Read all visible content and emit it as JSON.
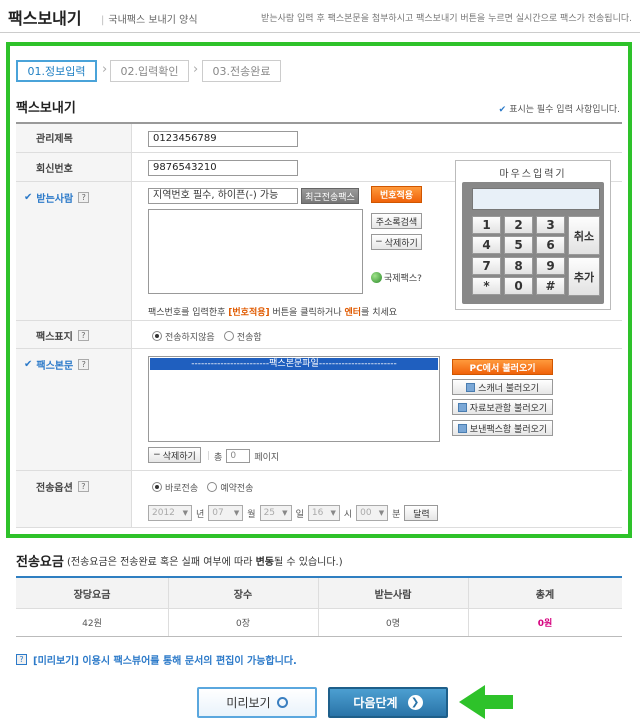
{
  "header": {
    "title": "팩스보내기",
    "subtitle": "국내팩스 보내기 양식",
    "description": "받는사람 입력 후 팩스본문을 첨부하시고 팩스보내기 버튼을 누르면 실시간으로 팩스가 전송됩니다."
  },
  "steps": [
    {
      "label": "01.정보입력",
      "active": true
    },
    {
      "label": "02.입력확인",
      "active": false
    },
    {
      "label": "03.전송완료",
      "active": false
    }
  ],
  "section_title": "팩스보내기",
  "required_note": "표시는 필수 입력 사항입니다.",
  "form": {
    "mgmt_title": {
      "label": "관리제목",
      "value": "0123456789"
    },
    "reply_number": {
      "label": "회신번호",
      "value": "9876543210"
    },
    "recipient": {
      "label": "받는사람",
      "input_value": "지역번호 필수, 하이픈(-) 가능",
      "recent_button": "최근전송팩스",
      "apply_button": "번호적용",
      "address_search_button": "주소록검색",
      "delete_button": "삭제하기",
      "intl_fax_link": "국제팩스?",
      "hint_prefix": "팩스번호를 입력한후",
      "hint_btn": "[번호적용]",
      "hint_mid": "버튼을 클릭하거나",
      "hint_enter": "엔터",
      "hint_suffix": "를 치세요"
    },
    "cover": {
      "label": "팩스표지",
      "options": [
        "전송하지않음",
        "전송함"
      ],
      "selected": "전송하지않음"
    },
    "body": {
      "label": "팩스본문",
      "list_item": "------------------------팩스본문파일------------------------",
      "pc_load_button": "PC에서 불러오기",
      "scanner_button": "스캐너 불러오기",
      "archive_button": "자료보관함 불러오기",
      "sent_fax_button": "보낸팩스함 불러오기",
      "delete_button": "삭제하기",
      "total_label": "총",
      "pages_value": "0",
      "pages_label": "페이지"
    },
    "send_option": {
      "label": "전송옵션",
      "options": [
        "바로전송",
        "예약전송"
      ],
      "selected": "바로전송",
      "year": "2012",
      "year_unit": "년",
      "month": "07",
      "month_unit": "월",
      "day": "25",
      "day_unit": "일",
      "hour": "16",
      "hour_unit": "시",
      "minute": "00",
      "minute_unit": "분",
      "calendar_button": "달력"
    }
  },
  "keypad": {
    "title": "마우스입력기",
    "keys": [
      "1",
      "2",
      "3",
      "4",
      "5",
      "6",
      "7",
      "8",
      "9",
      "*",
      "0",
      "#"
    ],
    "cancel": "취소",
    "add": "추가"
  },
  "fee": {
    "title": "전송요금",
    "note_prefix": "(전송요금은 전송완료 혹은 실패 여부에 따라 ",
    "note_bold": "변동",
    "note_suffix": "될 수 있습니다.)",
    "headers": [
      "장당요금",
      "장수",
      "받는사람",
      "총계"
    ],
    "values": [
      "42원",
      "0장",
      "0명",
      "0원"
    ]
  },
  "preview_note": "[미리보기] 이용시 팩스뷰어를 통해 문서의 편집이 가능합니다.",
  "footer": {
    "preview_button": "미리보기",
    "next_button": "다음단계"
  },
  "colors": {
    "highlight_border": "#2ec22a",
    "accent_blue": "#2c7ac9",
    "orange": "#f0620a",
    "total_pink": "#d6007e"
  }
}
